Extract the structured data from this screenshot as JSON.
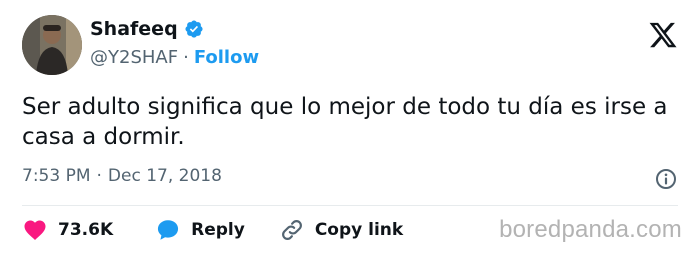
{
  "author": {
    "name": "Shafeeq",
    "handle": "@Y2SHAF",
    "separator": "·",
    "follow_label": "Follow",
    "verified": true
  },
  "tweet": {
    "text": "Ser adulto significa que lo mejor de todo tu día es irse a casa a dormir.",
    "time": "7:53 PM",
    "separator": "·",
    "date": "Dec 17, 2018"
  },
  "actions": {
    "like_count": "73.6K",
    "reply_label": "Reply",
    "copy_label": "Copy link"
  },
  "icons": {
    "brand": "x-logo-icon",
    "verified": "verified-badge-icon",
    "info": "info-icon",
    "like": "heart-icon",
    "reply": "speech-bubble-icon",
    "copy": "link-icon"
  },
  "colors": {
    "accent": "#1d9bf0",
    "heart": "#f91880",
    "text": "#0f1419",
    "muted": "#536471"
  },
  "watermark": "boredpanda.com"
}
